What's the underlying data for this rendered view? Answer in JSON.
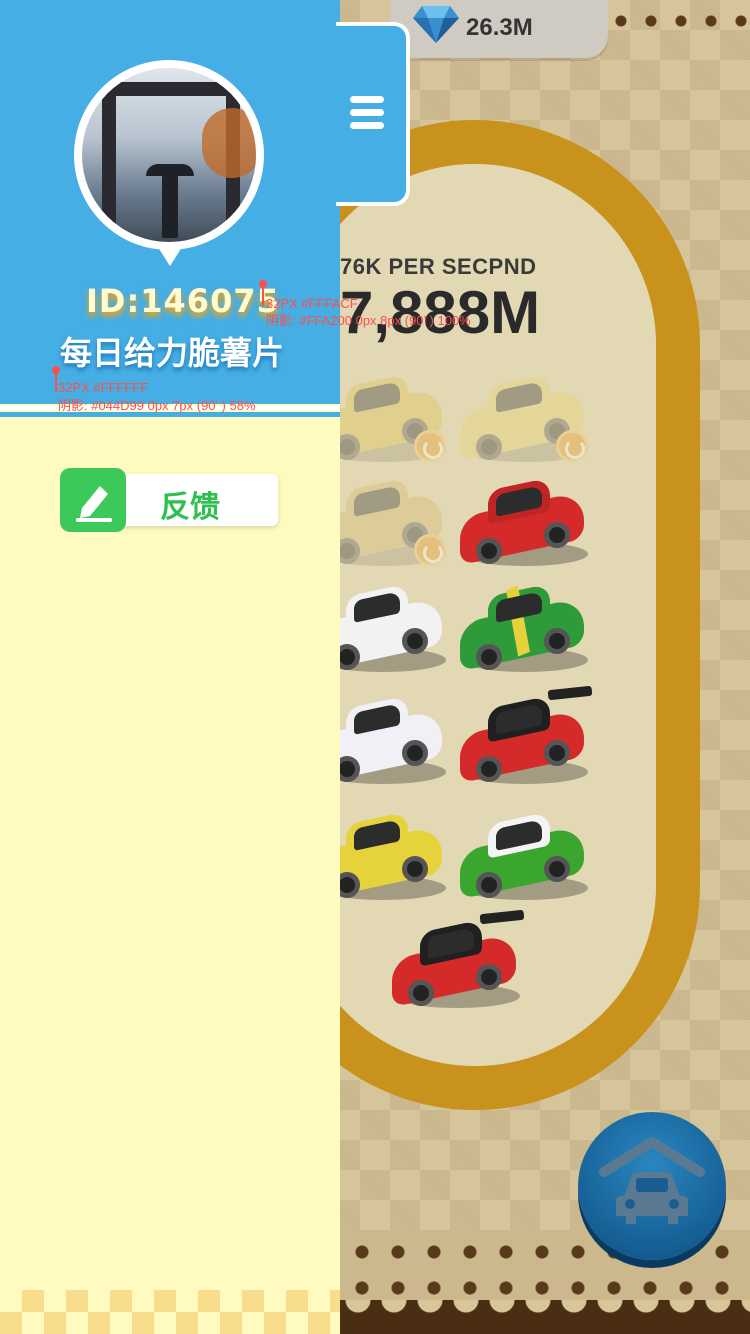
{
  "game": {
    "gems": "26.3M",
    "rate_label": "76K  PER SECPND",
    "money": "7,888M",
    "cars": [
      {
        "color": "#e0c04a",
        "state": "ghost",
        "roof": "#e0c04a"
      },
      {
        "color": "#e8d46a",
        "state": "ghost",
        "roof": "#e8d46a"
      },
      {
        "color": "#d4b86a",
        "state": "ghost",
        "roof": "#d4b86a"
      },
      {
        "color": "#d42a2a",
        "state": "normal",
        "roof": "#c02424"
      },
      {
        "color": "#f2f2f2",
        "state": "normal",
        "roof": "#f2f2f2"
      },
      {
        "color": "#2e9a3a",
        "state": "normal",
        "roof": "#2e9a3a"
      },
      {
        "color": "#f0f0f6",
        "state": "normal",
        "roof": "#f0f0f6"
      },
      {
        "color": "#d42a2a",
        "state": "normal",
        "roof": "#202020"
      },
      {
        "color": "#e6d23a",
        "state": "normal",
        "roof": "#e6d23a"
      },
      {
        "color": "#3aa62e",
        "state": "normal",
        "roof": "#f4f4f4"
      },
      {
        "color": "#d42a2a",
        "state": "normal",
        "roof": "#202020"
      }
    ],
    "garage_icon": "car-garage-icon"
  },
  "drawer": {
    "menu_icon": "hamburger-icon",
    "user_id": "ID:146075",
    "user_name": "每日给力脆薯片",
    "feedback": {
      "label": "反馈",
      "icon": "pencil-icon",
      "icon_color": "#3cc95a"
    },
    "annotations": {
      "id_spec_line1": "32PX #FFFACF",
      "id_spec_line2": "阴影: #FFA200 0px 8px (90’ ) 100%",
      "name_spec_line1": "32PX #FFFFFF",
      "name_spec_line2": "阴影: #044D99 0px 7px (90’ ) 58%"
    },
    "colors": {
      "header": "#45aee4",
      "panel": "#fffabf",
      "id_text": "#FFFACF",
      "id_shadow": "#FFA200",
      "name_text": "#FFFFFF",
      "name_shadow": "#044D99"
    }
  }
}
